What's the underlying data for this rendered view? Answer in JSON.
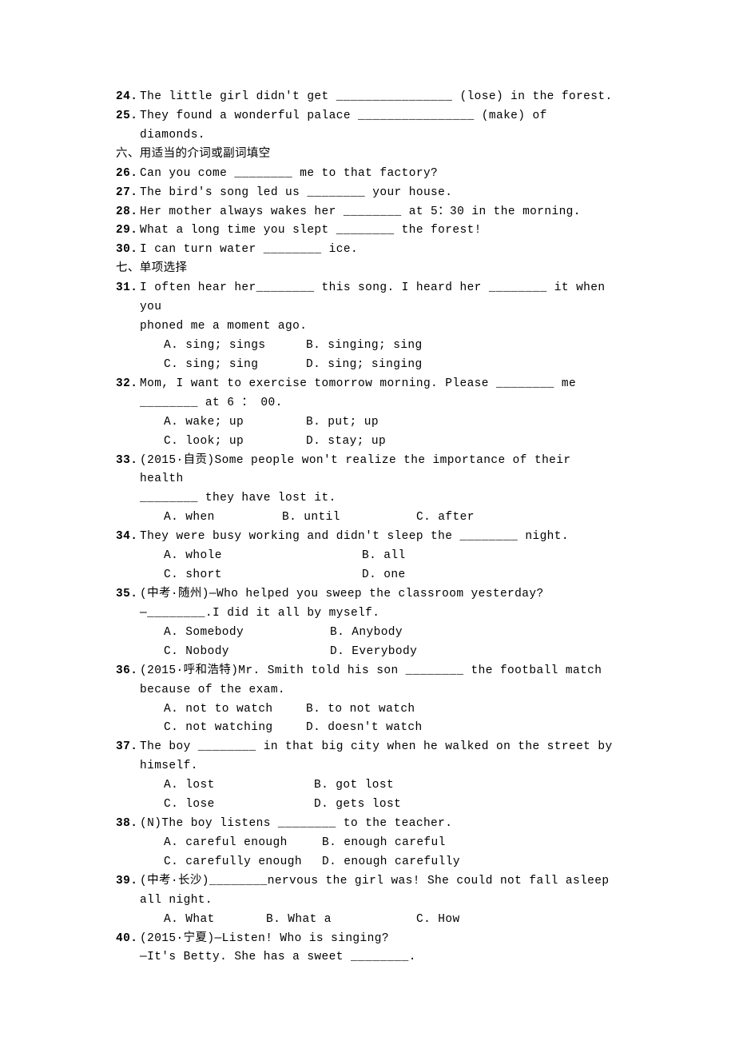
{
  "q24": {
    "num": "24.",
    "text": "The little girl didn't get ________________ (lose) in the forest."
  },
  "q25": {
    "num": "25.",
    "text": "They found a wonderful palace ________________ (make) of",
    "cont": "diamonds."
  },
  "sec6": "六、用适当的介词或副词填空",
  "q26": {
    "num": "26.",
    "text": "Can you come ________ me to that factory?"
  },
  "q27": {
    "num": "27.",
    "text": "The bird's song led us ________ your house."
  },
  "q28": {
    "num": "28.",
    "text": "Her mother always wakes her ________ at 5：30 in the morning."
  },
  "q29": {
    "num": "29.",
    "text": "What a long time you slept ________ the forest!"
  },
  "q30": {
    "num": "30.",
    "text": "I can turn water ________ ice."
  },
  "sec7": "七、单项选择",
  "q31": {
    "num": "31.",
    "text": "I often hear her________ this song. I heard her ________ it when you",
    "cont": "phoned me a moment ago.",
    "a": "A. sing; sings",
    "b": "B. singing; sing",
    "c": "C. sing; sing",
    "d": "D. sing; singing"
  },
  "q32": {
    "num": "32.",
    "text": "Mom, I want to exercise tomorrow morning. Please ________ me",
    "cont": "________ at 6 ： 00.",
    "a": "A. wake; up",
    "b": "B. put; up",
    "c": "C. look; up",
    "d": "D. stay; up"
  },
  "q33": {
    "num": "33.",
    "text": "(2015·自贡)Some people won't realize the importance of their health",
    "cont": "________ they have lost it.",
    "a": "A. when",
    "b": "B. until",
    "c": "C. after"
  },
  "q34": {
    "num": "34.",
    "text": "They were busy working and didn't sleep the ________ night.",
    "a": "A. whole",
    "b": "B. all",
    "c": "C. short",
    "d": "D. one"
  },
  "q35": {
    "num": "35.",
    "text": "(中考·随州)—Who helped you sweep the classroom yesterday?",
    "cont": "—________.I did it all by myself.",
    "a": "A. Somebody",
    "b": "B. Anybody",
    "c": "C. Nobody",
    "d": "D. Everybody"
  },
  "q36": {
    "num": "36.",
    "text": "(2015·呼和浩特)Mr. Smith told his son ________ the football match",
    "cont": "because of the exam.",
    "a": "A. not to watch",
    "b": "B. to not watch",
    "c": "C. not watching",
    "d": "D. doesn't watch"
  },
  "q37": {
    "num": "37.",
    "text": "The boy ________ in that big city when he walked on the street by",
    "cont": "himself.",
    "a": "A. lost",
    "b": "B. got lost",
    "c": "C. lose",
    "d": "D. gets lost"
  },
  "q38": {
    "num": "38.",
    "text": "(N)The boy listens ________ to  the teacher.",
    "a": "A. careful enough",
    "b": "B. enough careful",
    "c": "C. carefully enough",
    "d": "D. enough carefully"
  },
  "q39": {
    "num": "39.",
    "text": "(中考·长沙)________nervous the girl was! She could not fall asleep",
    "cont": "all night.",
    "a": "A. What",
    "b": "B. What a",
    "c": "C. How"
  },
  "q40": {
    "num": "40.",
    "text": "(2015·宁夏)—Listen! Who is singing?",
    "cont": "—It's Betty. She has a sweet ________."
  }
}
